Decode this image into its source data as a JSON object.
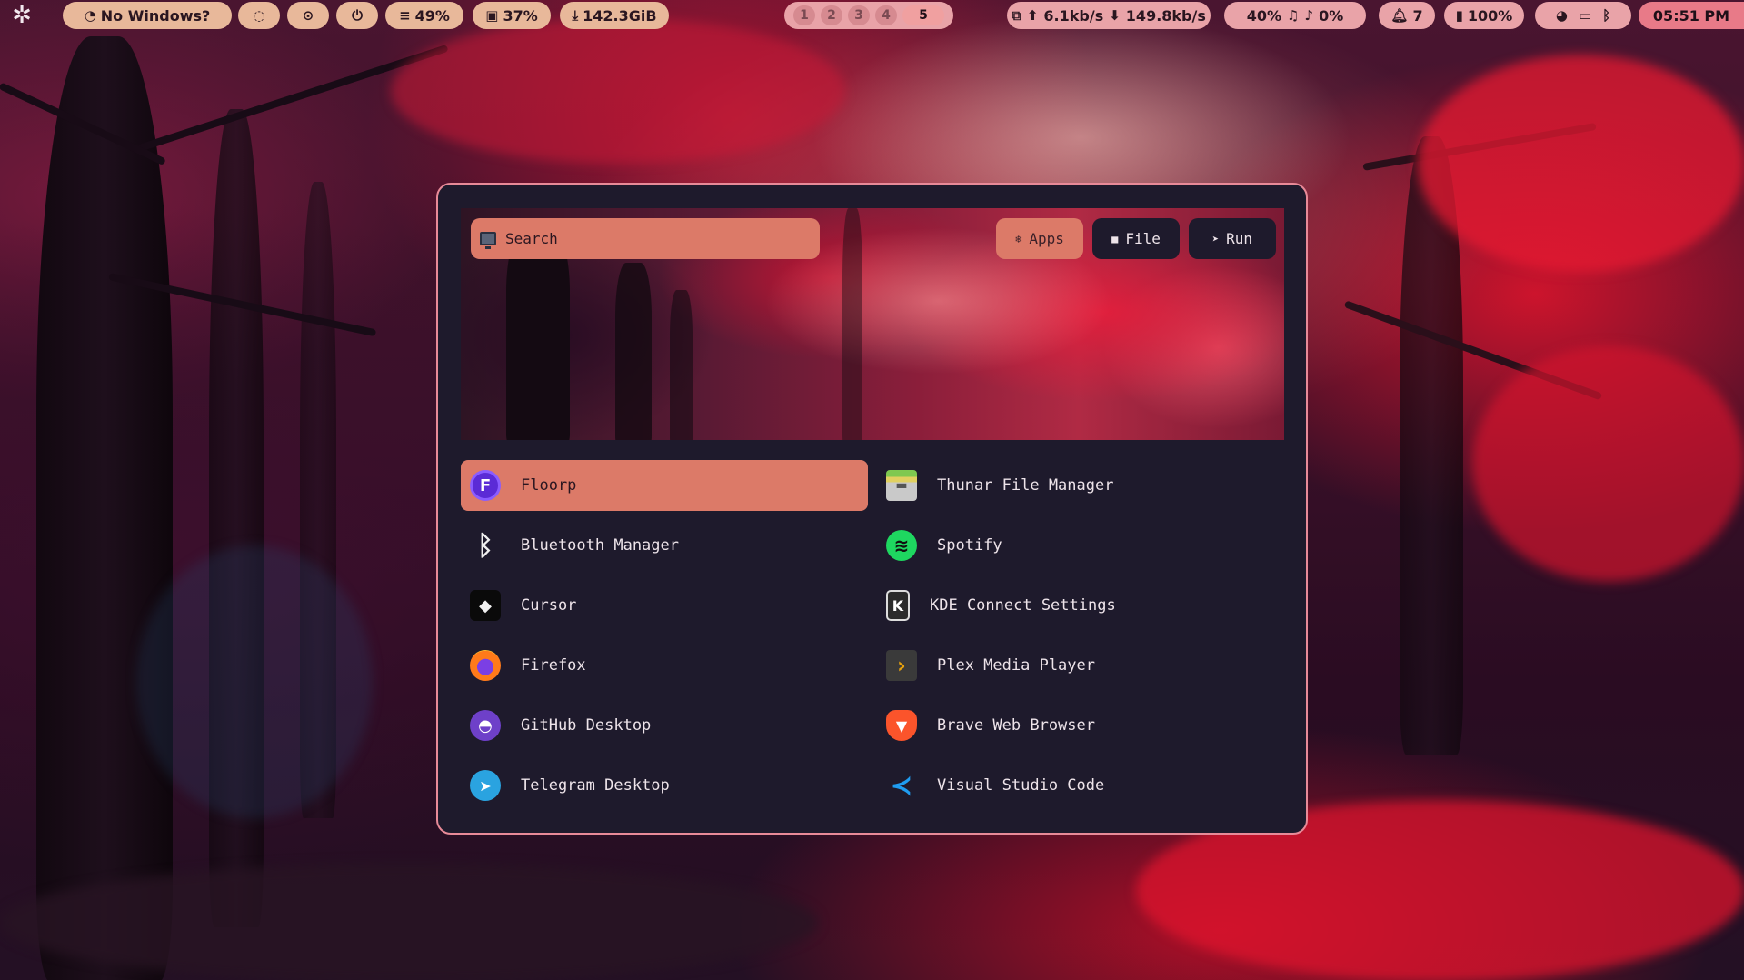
{
  "colors": {
    "accent": "#dc7a68",
    "launcher_bg": "#1e1a2c",
    "launcher_border": "#e88a98",
    "bar_pill": "#e8b89a",
    "bar_pill_pink": "#e9a3a8",
    "clock_bg": "#e87a88"
  },
  "topbar": {
    "logo_icon": "gear-flower-icon",
    "window_title": "No Windows?",
    "window_icon": "pacman-icon",
    "quick_icons": [
      "eye-off-icon",
      "screenshot-icon",
      "power-icon"
    ],
    "stats": {
      "memory": "49%",
      "cpu": "37%",
      "disk": "142.3GiB"
    },
    "workspaces": [
      "1",
      "2",
      "3",
      "4",
      "5"
    ],
    "active_workspace": "5",
    "network": {
      "up": "6.1kb/s",
      "down": "149.8kb/s"
    },
    "audio": {
      "volume": "40%",
      "mic": "0%"
    },
    "notifications": "7",
    "battery": "100%",
    "tray_icons": [
      "discord-icon",
      "monitor-icon",
      "bluetooth-icon"
    ],
    "clock": "05:51 PM"
  },
  "launcher": {
    "search": {
      "placeholder": "Search",
      "value": ""
    },
    "tabs": [
      {
        "label": "Apps",
        "icon": "apps-icon",
        "active": true
      },
      {
        "label": "File",
        "icon": "folder-icon",
        "active": false
      },
      {
        "label": "Run",
        "icon": "rocket-icon",
        "active": false
      }
    ],
    "apps": [
      {
        "label": "Floorp",
        "icon": "floorp-icon",
        "selected": true
      },
      {
        "label": "Thunar File Manager",
        "icon": "thunar-icon"
      },
      {
        "label": "Bluetooth Manager",
        "icon": "bluetooth-icon"
      },
      {
        "label": "Spotify",
        "icon": "spotify-icon"
      },
      {
        "label": "Cursor",
        "icon": "cursor-icon"
      },
      {
        "label": "KDE Connect Settings",
        "icon": "kde-connect-icon"
      },
      {
        "label": "Firefox",
        "icon": "firefox-icon"
      },
      {
        "label": "Plex Media Player",
        "icon": "plex-icon"
      },
      {
        "label": "GitHub Desktop",
        "icon": "github-icon"
      },
      {
        "label": "Brave Web Browser",
        "icon": "brave-icon"
      },
      {
        "label": "Telegram Desktop",
        "icon": "telegram-icon"
      },
      {
        "label": "Visual Studio Code",
        "icon": "vscode-icon"
      }
    ]
  }
}
